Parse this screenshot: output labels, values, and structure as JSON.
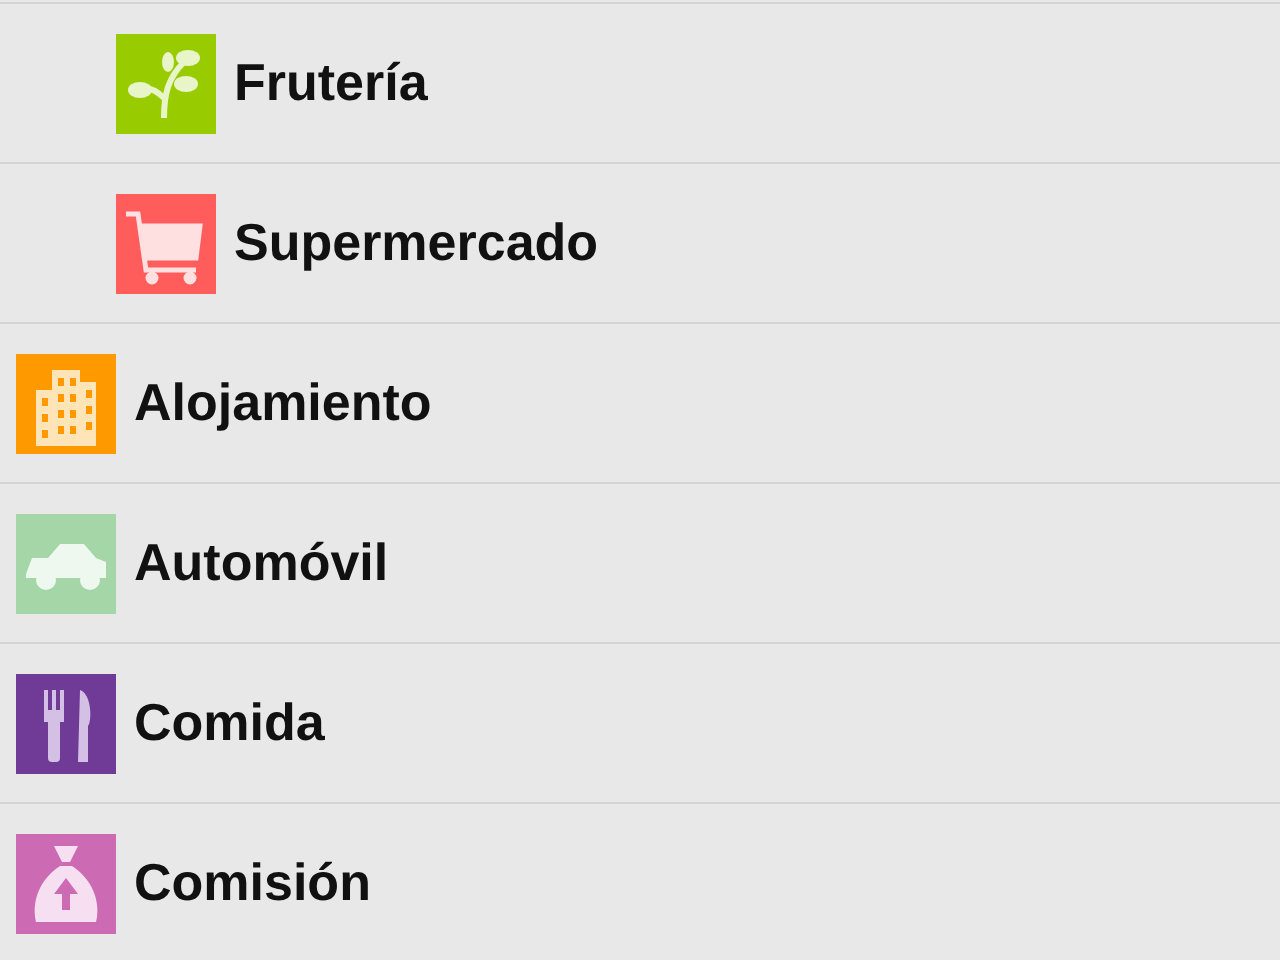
{
  "subcategories": [
    {
      "label": "Frutería",
      "color": "#99cc00"
    },
    {
      "label": "Supermercado",
      "color": "#ff5c5c"
    }
  ],
  "categories": [
    {
      "label": "Alojamiento",
      "color": "#ff9900"
    },
    {
      "label": "Automóvil",
      "color": "#a5d6a7"
    },
    {
      "label": "Comida",
      "color": "#6f3b96"
    },
    {
      "label": "Comisión",
      "color": "#cc6bb3"
    }
  ]
}
